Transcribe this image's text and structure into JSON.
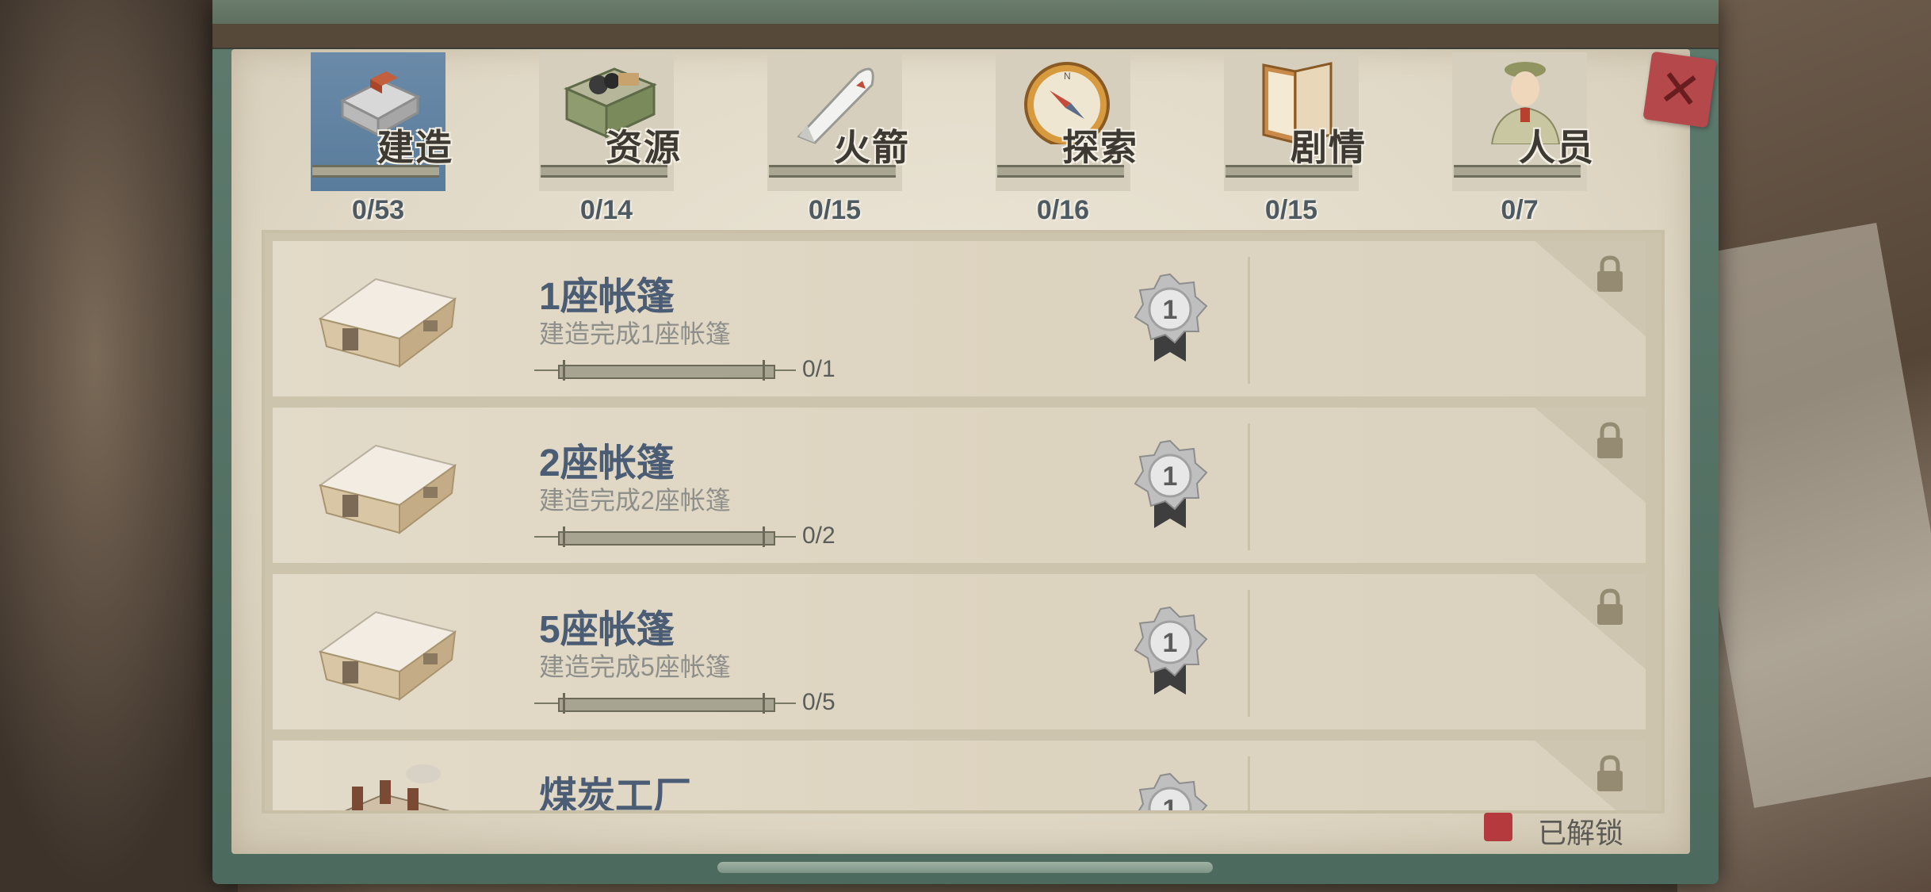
{
  "tabs": [
    {
      "label": "建造",
      "count": "0/53",
      "active": true,
      "icon": "brick-icon"
    },
    {
      "label": "资源",
      "count": "0/14",
      "active": false,
      "icon": "resource-crate-icon"
    },
    {
      "label": "火箭",
      "count": "0/15",
      "active": false,
      "icon": "rocket-icon"
    },
    {
      "label": "探索",
      "count": "0/16",
      "active": false,
      "icon": "compass-icon"
    },
    {
      "label": "剧情",
      "count": "0/15",
      "active": false,
      "icon": "book-icon"
    },
    {
      "label": "人员",
      "count": "0/7",
      "active": false,
      "icon": "officer-icon"
    }
  ],
  "close_icon": "close-icon",
  "achievements": [
    {
      "title": "1座帐篷",
      "description": "建造完成1座帐篷",
      "progress": "0/1",
      "medal_level": "1",
      "locked": true,
      "icon": "tent-icon"
    },
    {
      "title": "2座帐篷",
      "description": "建造完成2座帐篷",
      "progress": "0/2",
      "medal_level": "1",
      "locked": true,
      "icon": "tent-icon"
    },
    {
      "title": "5座帐篷",
      "description": "建造完成5座帐篷",
      "progress": "0/5",
      "medal_level": "1",
      "locked": true,
      "icon": "tent-icon"
    },
    {
      "title": "煤炭工厂",
      "description": "",
      "progress": "",
      "medal_level": "1",
      "locked": true,
      "icon": "coal-factory-icon"
    }
  ],
  "legend": {
    "label": "已解锁",
    "color": "#b53a3e"
  },
  "colors": {
    "active_tab": "#6a8aa8",
    "title": "#4b5d75",
    "paper": "#e3dbc9"
  }
}
